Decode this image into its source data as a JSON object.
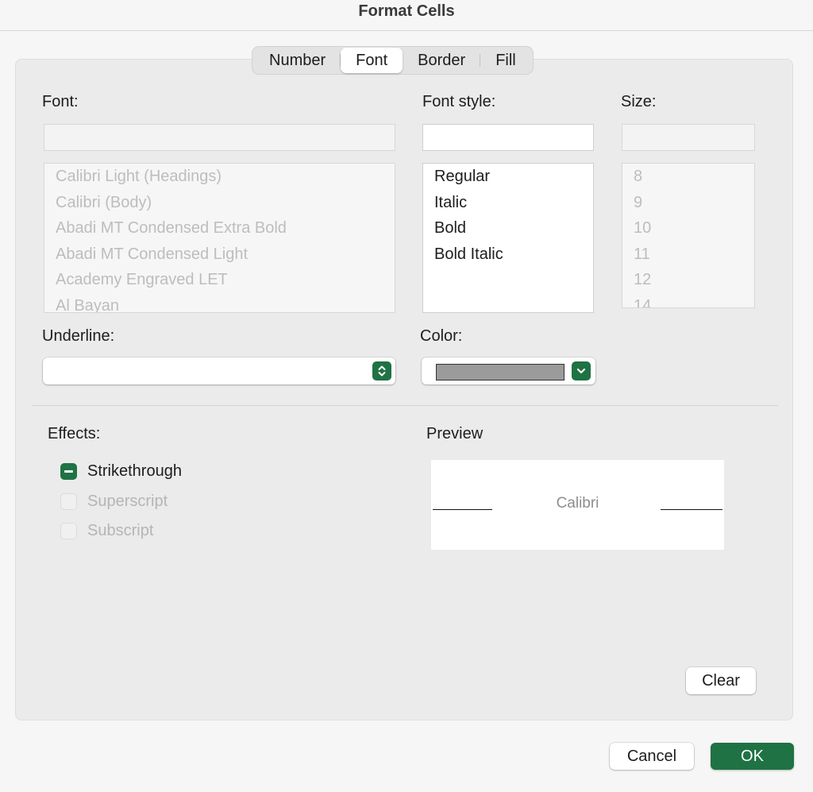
{
  "window": {
    "title": "Format Cells"
  },
  "tabs": [
    {
      "label": "Number",
      "active": false
    },
    {
      "label": "Font",
      "active": true
    },
    {
      "label": "Border",
      "active": false
    },
    {
      "label": "Fill",
      "active": false
    }
  ],
  "font": {
    "label": "Font:",
    "value": "",
    "items": [
      "Calibri Light (Headings)",
      "Calibri (Body)",
      "Abadi MT Condensed Extra Bold",
      "Abadi MT Condensed Light",
      "Academy Engraved LET",
      "Al Bayan"
    ]
  },
  "font_style": {
    "label": "Font style:",
    "value": "",
    "items": [
      "Regular",
      "Italic",
      "Bold",
      "Bold Italic"
    ]
  },
  "size": {
    "label": "Size:",
    "value": "",
    "items": [
      "8",
      "9",
      "10",
      "11",
      "12",
      "14"
    ]
  },
  "underline": {
    "label": "Underline:",
    "value": ""
  },
  "color": {
    "label": "Color:",
    "swatch": "#9b9b9b"
  },
  "effects": {
    "label": "Effects:",
    "strikethrough": {
      "label": "Strikethrough",
      "state": "mixed"
    },
    "superscript": {
      "label": "Superscript",
      "state": "unchecked",
      "disabled": true
    },
    "subscript": {
      "label": "Subscript",
      "state": "unchecked",
      "disabled": true
    }
  },
  "preview": {
    "label": "Preview",
    "sample": "Calibri"
  },
  "buttons": {
    "clear": "Clear",
    "cancel": "Cancel",
    "ok": "OK"
  },
  "colors": {
    "accent": "#1f7244"
  }
}
